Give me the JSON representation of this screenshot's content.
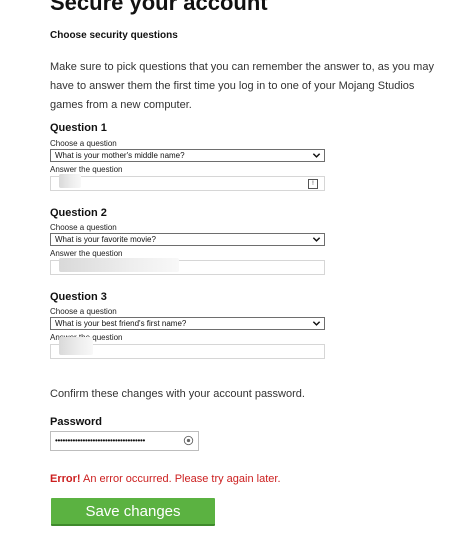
{
  "page": {
    "title": "Secure your account",
    "section_heading": "Choose security questions",
    "intro": "Make sure to pick questions that you can remember the answer to, as you may have to answer them the first time you log in to one of your Mojang Studios games from a new computer."
  },
  "questions": [
    {
      "heading": "Question 1",
      "choose_label": "Choose a question",
      "selected": "What is your mother's middle name?",
      "answer_label": "Answer the question"
    },
    {
      "heading": "Question 2",
      "choose_label": "Choose a question",
      "selected": "What is your favorite movie?",
      "answer_label": "Answer the question"
    },
    {
      "heading": "Question 3",
      "choose_label": "Choose a question",
      "selected": "What is your best friend's first name?",
      "answer_label": "Answer the question"
    }
  ],
  "confirm": {
    "text": "Confirm these changes with your account password.",
    "password_label": "Password",
    "password_value": "••••••••••••••••••••••••••••••••••••"
  },
  "error": {
    "prefix": "Error!",
    "message": " An error occurred. Please try again later."
  },
  "actions": {
    "save_label": "Save changes"
  },
  "colors": {
    "error": "#cc1f1f",
    "save_button": "#5bb241"
  },
  "icons": {
    "dropdown": "chevron-down-icon",
    "password_reveal": "eye-icon",
    "answer_reveal": "reveal-icon"
  }
}
